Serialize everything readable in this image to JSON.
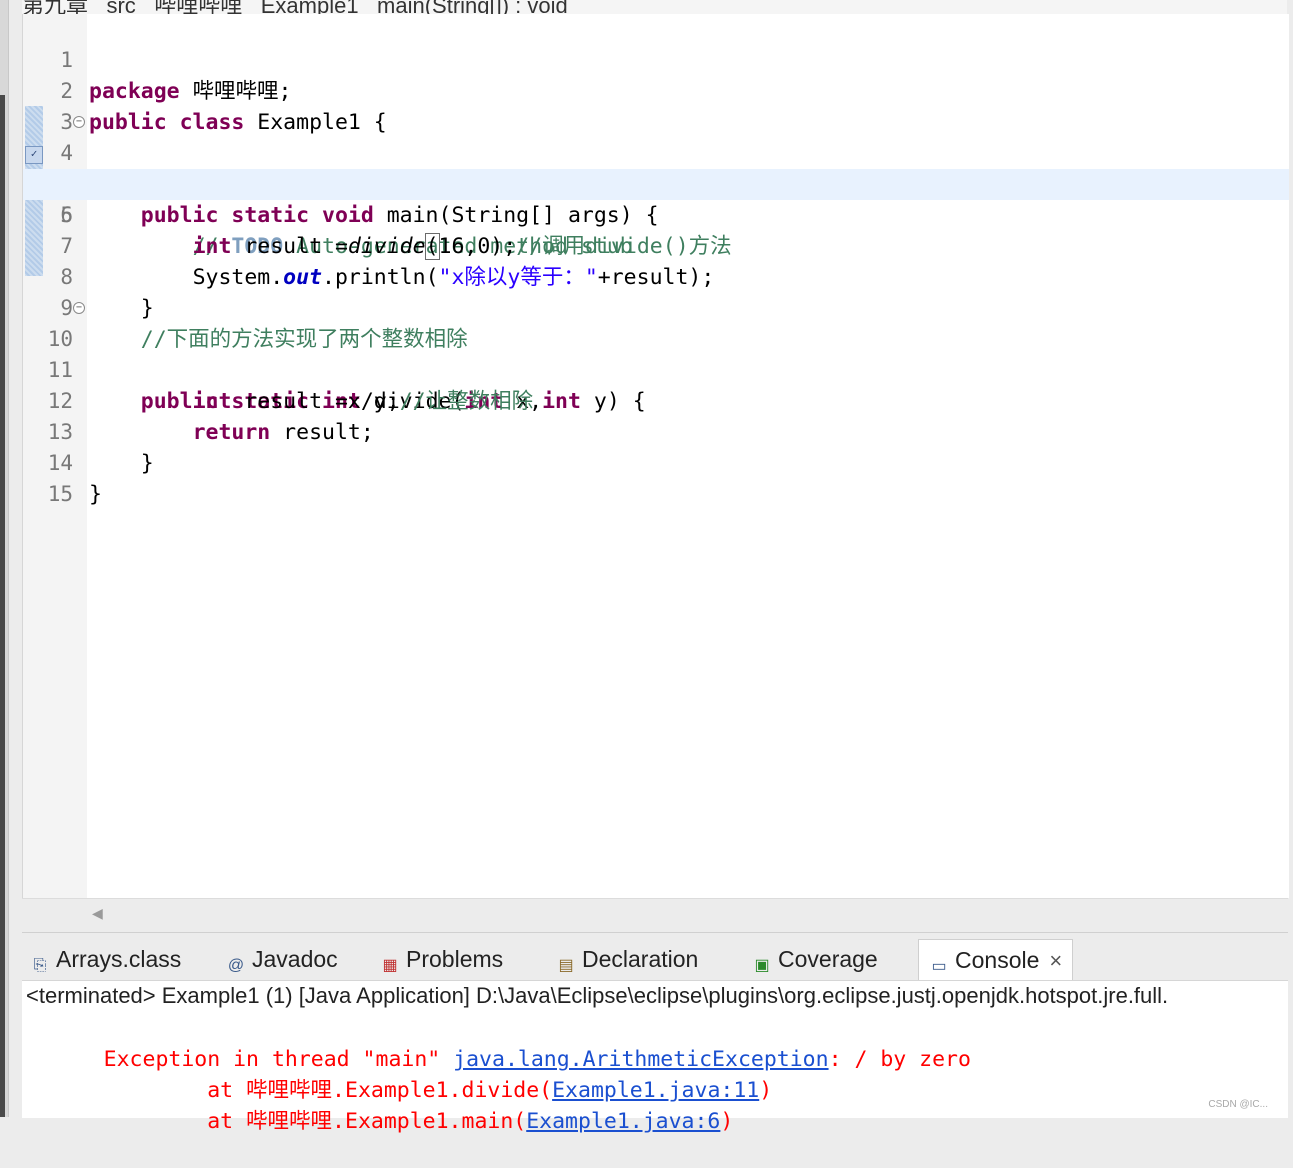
{
  "breadcrumb": {
    "items": [
      "第九章",
      "src",
      "哔哩哔哩",
      "Example1",
      "main(String[]) : void"
    ]
  },
  "editor": {
    "lines": [
      {
        "num": "1"
      },
      {
        "num": "2"
      },
      {
        "num": "3"
      },
      {
        "num": "4"
      },
      {
        "num": "5"
      },
      {
        "num": "6"
      },
      {
        "num": "7"
      },
      {
        "num": "8"
      },
      {
        "num": "9"
      },
      {
        "num": "10"
      },
      {
        "num": "11"
      },
      {
        "num": "12"
      },
      {
        "num": "13"
      },
      {
        "num": "14"
      },
      {
        "num": "15"
      }
    ],
    "code": {
      "l1_kw": "package",
      "l1_rest": " 哔哩哔哩;",
      "l2_kw": "public class",
      "l2_rest": " Example1 {",
      "l4_indent": "    ",
      "l4_kw": "public static void",
      "l4_rest": " main(String[] args) {",
      "l5_indent": "        ",
      "l5_c1": "// ",
      "l5_todo": "TODO",
      "l5_c2": " Auto-generated method stub",
      "l6_indent": "        ",
      "l6_kw": "int",
      "l6_a": " result =",
      "l6_call": "divide",
      "l6_paren": "(",
      "l6_b": "16,0);",
      "l6_cm": "//调用divide()方法",
      "l7_indent": "        ",
      "l7_a": "System.",
      "l7_field": "out",
      "l7_b": ".println(",
      "l7_str": "\"x除以y等于：\"",
      "l7_c": "+result);",
      "l8_text": "    }",
      "l9_indent": "    ",
      "l9_cm": "//下面的方法实现了两个整数相除",
      "l10_indent": "    ",
      "l10_kw": "public static int",
      "l10_a": " divide(",
      "l10_kw2": "int",
      "l10_b": " x,",
      "l10_kw3": "int",
      "l10_c": " y) {",
      "l11_indent": "        ",
      "l11_kw": "int",
      "l11_a": " result =x/y;",
      "l11_cm": "//让整数相除",
      "l12_indent": "        ",
      "l12_kw": "return",
      "l12_a": " result;",
      "l13_text": "    }",
      "l14_text": "}"
    }
  },
  "tabs": [
    {
      "label": "Arrays.class"
    },
    {
      "label": "Javadoc"
    },
    {
      "label": "Problems"
    },
    {
      "label": "Declaration"
    },
    {
      "label": "Coverage"
    },
    {
      "label": "Console"
    }
  ],
  "console": {
    "status": "<terminated> Example1 (1) [Java Application] D:\\Java\\Eclipse\\eclipse\\plugins\\org.eclipse.justj.openjdk.hotspot.jre.full.",
    "line1_prefix": "Exception in thread \"main\" ",
    "line1_link": "java.lang.ArithmeticException",
    "line1_suffix": ": / by zero",
    "line2_prefix": "        at 哔哩哔哩.Example1.divide(",
    "line2_link": "Example1.java:11",
    "line2_suffix": ")",
    "line3_prefix": "        at 哔哩哔哩.Example1.main(",
    "line3_link": "Example1.java:6",
    "line3_suffix": ")"
  },
  "watermark": "CSDN @IC..."
}
